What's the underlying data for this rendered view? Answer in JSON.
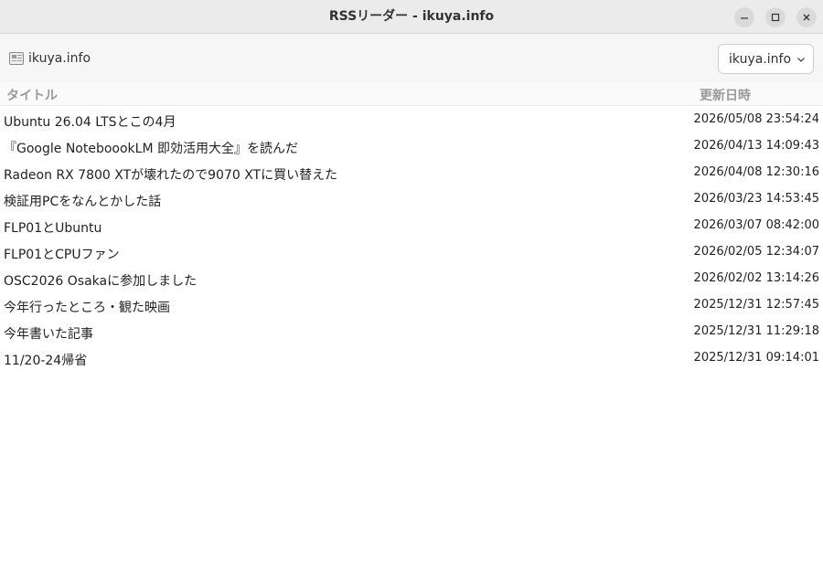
{
  "window": {
    "title": "RSSリーダー - ikuya.info"
  },
  "toolbar": {
    "feed_label": "ikuya.info",
    "feed_icon": "newspaper-icon",
    "feed_select_value": "ikuya.info"
  },
  "table": {
    "headers": {
      "title": "タイトル",
      "date": "更新日時"
    },
    "rows": [
      {
        "title": "Ubuntu 26.04 LTSとこの4月",
        "date": "2026/05/08 23:54:24"
      },
      {
        "title": "『Google NoteboookLM 即効活用大全』を読んだ",
        "date": "2026/04/13 14:09:43"
      },
      {
        "title": "Radeon RX 7800 XTが壊れたので9070 XTに買い替えた",
        "date": "2026/04/08 12:30:16"
      },
      {
        "title": "検証用PCをなんとかした話",
        "date": "2026/03/23 14:53:45"
      },
      {
        "title": "FLP01とUbuntu",
        "date": "2026/03/07 08:42:00"
      },
      {
        "title": "FLP01とCPUファン",
        "date": "2026/02/05 12:34:07"
      },
      {
        "title": "OSC2026 Osakaに参加しました",
        "date": "2026/02/02 13:14:26"
      },
      {
        "title": "今年行ったところ・観た映画",
        "date": "2025/12/31 12:57:45"
      },
      {
        "title": "今年書いた記事",
        "date": "2025/12/31 11:29:18"
      },
      {
        "title": "11/20-24帰省",
        "date": "2025/12/31 09:14:01"
      }
    ]
  }
}
